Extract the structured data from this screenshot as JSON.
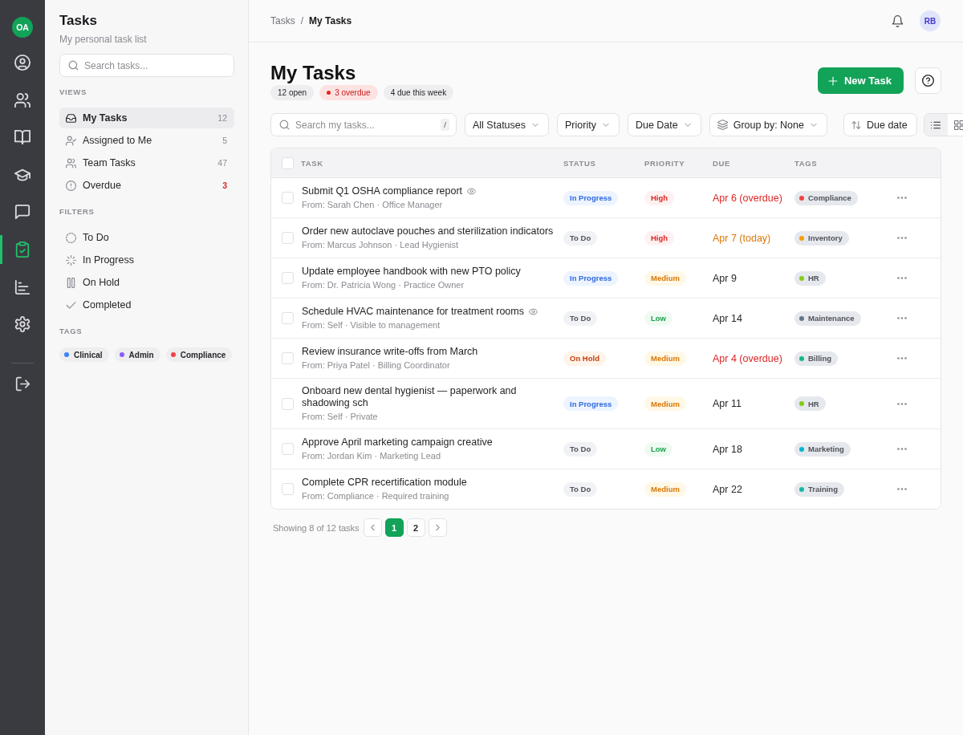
{
  "rail": {
    "avatar": "OA",
    "items": [
      {
        "selected": false
      },
      {
        "selected": false
      },
      {
        "selected": false
      },
      {
        "selected": false
      },
      {
        "selected": false
      },
      {
        "selected": true
      },
      {
        "selected": false
      },
      {
        "selected": false
      }
    ]
  },
  "sidebar": {
    "title": "Tasks",
    "subtitle": "My personal task list",
    "search": {
      "placeholder": "Search tasks..."
    },
    "views": {
      "heading": "VIEWS",
      "items": [
        {
          "label": "My Tasks",
          "count": "12",
          "selected": true,
          "alert": false
        },
        {
          "label": "Assigned to Me",
          "count": "5",
          "selected": false,
          "alert": false
        },
        {
          "label": "Team Tasks",
          "count": "47",
          "selected": false,
          "alert": false
        },
        {
          "label": "Overdue",
          "count": "3",
          "selected": false,
          "alert": true
        }
      ]
    },
    "filters": {
      "heading": "FILTERS",
      "items": [
        {
          "label": "To Do"
        },
        {
          "label": "In Progress"
        },
        {
          "label": "On Hold"
        },
        {
          "label": "Completed"
        }
      ]
    },
    "tags": {
      "heading": "TAGS",
      "items": [
        {
          "label": "Clinical",
          "color": "#3b82f6"
        },
        {
          "label": "Admin",
          "color": "#8b5cf6"
        },
        {
          "label": "Compliance",
          "color": "#ef4444"
        }
      ]
    }
  },
  "header": {
    "breadcrumb": [
      {
        "label": "Tasks",
        "current": false
      },
      {
        "label": "My Tasks",
        "current": true
      }
    ],
    "separator": "/",
    "user_avatar": "RB"
  },
  "page": {
    "title": "My Tasks",
    "summary": [
      {
        "label": "12 open",
        "kind": "neutral"
      },
      {
        "label": "3 overdue",
        "kind": "alert"
      },
      {
        "label": "4 due this week",
        "kind": "neutral"
      }
    ],
    "new_button": "New Task"
  },
  "toolbar": {
    "search": {
      "placeholder": "Search my tasks...",
      "shortcut": "/"
    },
    "filters": [
      {
        "label": "All Statuses",
        "kind": "dropdown"
      },
      {
        "label": "Priority",
        "kind": "dropdown"
      },
      {
        "label": "Due Date",
        "kind": "dropdown"
      },
      {
        "label": "Group by: None",
        "kind": "group"
      }
    ],
    "sort": "Due date",
    "views": [
      {
        "selected": true
      },
      {
        "selected": false
      }
    ]
  },
  "table": {
    "select_all": {
      "checked": false
    },
    "columns": [
      "TASK",
      "STATUS",
      "PRIORITY",
      "DUE",
      "TAGS"
    ],
    "rows": [
      {
        "checked": false,
        "title": "Submit Q1 OSHA compliance report",
        "watched": true,
        "from": "From: Sarah Chen · Office Manager",
        "status": {
          "label": "In Progress",
          "kind": "in_progress"
        },
        "priority": {
          "label": "High",
          "kind": "high"
        },
        "due": {
          "label": "Apr 6 (overdue)",
          "kind": "overdue"
        },
        "tag": {
          "label": "Compliance",
          "color": "#ef4444"
        }
      },
      {
        "checked": false,
        "title": "Order new autoclave pouches and sterilization indicators",
        "watched": false,
        "from": "From: Marcus Johnson · Lead Hygienist",
        "status": {
          "label": "To Do",
          "kind": "todo"
        },
        "priority": {
          "label": "High",
          "kind": "high"
        },
        "due": {
          "label": "Apr 7 (today)",
          "kind": "today"
        },
        "tag": {
          "label": "Inventory",
          "color": "#f59e0b"
        }
      },
      {
        "checked": false,
        "title": "Update employee handbook with new PTO policy",
        "watched": false,
        "from": "From: Dr. Patricia Wong · Practice Owner",
        "status": {
          "label": "In Progress",
          "kind": "in_progress"
        },
        "priority": {
          "label": "Medium",
          "kind": "medium"
        },
        "due": {
          "label": "Apr 9",
          "kind": "normal"
        },
        "tag": {
          "label": "HR",
          "color": "#84cc16"
        }
      },
      {
        "checked": false,
        "title": "Schedule HVAC maintenance for treatment rooms",
        "watched": true,
        "from": "From: Self · Visible to management",
        "status": {
          "label": "To Do",
          "kind": "todo"
        },
        "priority": {
          "label": "Low",
          "kind": "low"
        },
        "due": {
          "label": "Apr 14",
          "kind": "normal"
        },
        "tag": {
          "label": "Maintenance",
          "color": "#64748b"
        }
      },
      {
        "checked": false,
        "title": "Review insurance write-offs from March",
        "watched": false,
        "from": "From: Priya Patel · Billing Coordinator",
        "status": {
          "label": "On Hold",
          "kind": "on_hold"
        },
        "priority": {
          "label": "Medium",
          "kind": "medium"
        },
        "due": {
          "label": "Apr 4 (overdue)",
          "kind": "overdue"
        },
        "tag": {
          "label": "Billing",
          "color": "#10b981"
        }
      },
      {
        "checked": false,
        "title": "Onboard new dental hygienist — paperwork and shadowing sch",
        "watched": false,
        "from": "From: Self · Private",
        "status": {
          "label": "In Progress",
          "kind": "in_progress"
        },
        "priority": {
          "label": "Medium",
          "kind": "medium"
        },
        "due": {
          "label": "Apr 11",
          "kind": "normal"
        },
        "tag": {
          "label": "HR",
          "color": "#84cc16"
        }
      },
      {
        "checked": false,
        "title": "Approve April marketing campaign creative",
        "watched": false,
        "from": "From: Jordan Kim · Marketing Lead",
        "status": {
          "label": "To Do",
          "kind": "todo"
        },
        "priority": {
          "label": "Low",
          "kind": "low"
        },
        "due": {
          "label": "Apr 18",
          "kind": "normal"
        },
        "tag": {
          "label": "Marketing",
          "color": "#06b6d4"
        }
      },
      {
        "checked": false,
        "title": "Complete CPR recertification module",
        "watched": false,
        "from": "From: Compliance · Required training",
        "status": {
          "label": "To Do",
          "kind": "todo"
        },
        "priority": {
          "label": "Medium",
          "kind": "medium"
        },
        "due": {
          "label": "Apr 22",
          "kind": "normal"
        },
        "tag": {
          "label": "Training",
          "color": "#14b8a6"
        }
      }
    ]
  },
  "pagination": {
    "summary": "Showing 8 of 12 tasks",
    "pages": [
      {
        "label": "1",
        "selected": true
      },
      {
        "label": "2",
        "selected": false
      }
    ]
  }
}
